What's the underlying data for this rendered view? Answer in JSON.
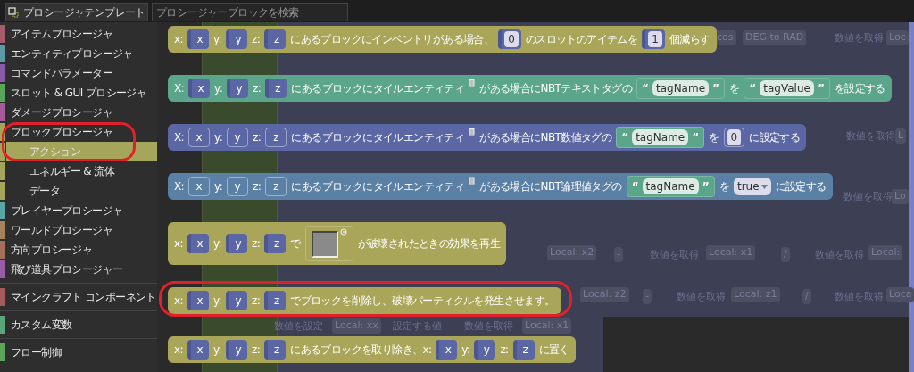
{
  "toolbar": {
    "tab": {
      "label": "プロシージャテンプレート",
      "selected": true
    },
    "search": {
      "placeholder": "プロシージャーブロックを検索"
    }
  },
  "sidebar": {
    "groups": [
      {
        "items": [
          {
            "label": "アイテムプロシージャ",
            "color": "#a55b6b",
            "selected": false
          },
          {
            "label": "エンティティプロシージャ",
            "color": "#5b99a5",
            "selected": false
          },
          {
            "label": "コマンドパラメーター",
            "color": "#8a5ba5",
            "selected": false
          },
          {
            "label": "スロット & GUI プロシージャ",
            "color": "#5ba55b",
            "selected": false
          },
          {
            "label": "ダメージプロシージャ",
            "color": "#a55b99",
            "selected": false
          },
          {
            "label": "ブロックプロシージャ",
            "color": "#a5a55b",
            "selected": false,
            "children": [
              {
                "label": "アクション",
                "color": "#a5a55b",
                "selected": true
              },
              {
                "label": "エネルギー & 流体",
                "color": "#a5a55b",
                "selected": false
              },
              {
                "label": "データ",
                "color": "#a5a55b",
                "selected": false
              }
            ]
          },
          {
            "label": "プレイヤープロシージャ",
            "color": "#5ba5a5",
            "selected": false
          },
          {
            "label": "ワールドプロシージャ",
            "color": "#a5825b",
            "selected": false
          },
          {
            "label": "方向プロシージャ",
            "color": "#a5705b",
            "selected": false
          },
          {
            "label": "飛び道具プロシージャー",
            "color": "#995ba5",
            "selected": false
          }
        ]
      },
      {
        "items": [
          {
            "label": "マインクラフト コンポーネント",
            "color": "#a55b5b",
            "selected": false
          }
        ]
      },
      {
        "items": [
          {
            "label": "カスタム変数",
            "color": "#5ba57a",
            "selected": false
          }
        ]
      },
      {
        "items": [
          {
            "label": "フロー制御",
            "color": "#5ba55b",
            "selected": false
          }
        ]
      }
    ]
  },
  "background_blocks": [
    {
      "kind": "chip",
      "text": "cos"
    },
    {
      "kind": "chip",
      "text": "DEG to RAD"
    },
    {
      "kind": "label",
      "text": "数値を取得"
    },
    {
      "kind": "chip",
      "text": "Loc"
    },
    {
      "kind": "label",
      "text": "数値を取得"
    },
    {
      "kind": "chip",
      "text": "L"
    },
    {
      "kind": "label",
      "text": "数値を取得"
    },
    {
      "kind": "chip",
      "text": "Lo"
    },
    {
      "kind": "chip",
      "text": "Local: x2"
    },
    {
      "kind": "chip",
      "text": "-"
    },
    {
      "kind": "label",
      "text": "数値を取得"
    },
    {
      "kind": "chip",
      "text": "Local: x1"
    },
    {
      "kind": "chip",
      "text": "/"
    },
    {
      "kind": "label",
      "text": "数値を取得"
    },
    {
      "kind": "chip",
      "text": "Local:"
    },
    {
      "kind": "chip",
      "text": "Local: z2"
    },
    {
      "kind": "chip",
      "text": "-"
    },
    {
      "kind": "label",
      "text": "数値を取得"
    },
    {
      "kind": "chip",
      "text": "Local: z1"
    },
    {
      "kind": "chip",
      "text": "/"
    },
    {
      "kind": "label",
      "text": "数値を取得"
    },
    {
      "kind": "chip",
      "text": "Loca"
    },
    {
      "kind": "label",
      "text": "数値を設定"
    },
    {
      "kind": "chip",
      "text": "Local: xx"
    },
    {
      "kind": "label",
      "text": "設定する値"
    },
    {
      "kind": "label",
      "text": "数値を取得"
    },
    {
      "kind": "chip",
      "text": "Local: x1"
    }
  ],
  "blocks": [
    {
      "color": "#a9a65a",
      "highlighted": false,
      "parts": [
        {
          "kind": "label",
          "text": "x:"
        },
        {
          "kind": "var",
          "text": "x"
        },
        {
          "kind": "label",
          "text": "y:"
        },
        {
          "kind": "var",
          "text": "y"
        },
        {
          "kind": "label",
          "text": "z:"
        },
        {
          "kind": "var",
          "text": "z"
        },
        {
          "kind": "label",
          "text": "にあるブロックにインベントリがある場合、"
        },
        {
          "kind": "number",
          "text": "0"
        },
        {
          "kind": "label",
          "text": "のスロットのアイテムを"
        },
        {
          "kind": "number",
          "text": "1"
        },
        {
          "kind": "label",
          "text": "個減らす"
        }
      ]
    },
    {
      "color": "#5ba58a",
      "highlighted": false,
      "parts": [
        {
          "kind": "label",
          "text": "X:"
        },
        {
          "kind": "var",
          "text": "x"
        },
        {
          "kind": "label",
          "text": "y:"
        },
        {
          "kind": "var",
          "text": "y"
        },
        {
          "kind": "label",
          "text": "z:"
        },
        {
          "kind": "var",
          "text": "z"
        },
        {
          "kind": "label",
          "text": "にあるブロックにタイルエンティティ"
        },
        {
          "kind": "icon"
        },
        {
          "kind": "label",
          "text": "がある場合にNBTテキストタグの"
        },
        {
          "kind": "string",
          "open": "“",
          "text": "tagName",
          "close": "”"
        },
        {
          "kind": "label",
          "text": "を"
        },
        {
          "kind": "string",
          "open": "“",
          "text": "tagValue",
          "close": "”"
        },
        {
          "kind": "label",
          "text": "を設定する"
        }
      ]
    },
    {
      "color": "#5b67a5",
      "highlighted": false,
      "parts": [
        {
          "kind": "label",
          "text": "X:"
        },
        {
          "kind": "empty",
          "text": "x"
        },
        {
          "kind": "label",
          "text": "y:"
        },
        {
          "kind": "empty",
          "text": "y"
        },
        {
          "kind": "label",
          "text": "z:"
        },
        {
          "kind": "empty",
          "text": "z"
        },
        {
          "kind": "label",
          "text": "にあるブロックにタイルエンティティ"
        },
        {
          "kind": "icon"
        },
        {
          "kind": "label",
          "text": "がある場合にNBT数値タグの"
        },
        {
          "kind": "string",
          "open": "“",
          "text": "tagName",
          "close": "”"
        },
        {
          "kind": "label",
          "text": "を"
        },
        {
          "kind": "empty_number",
          "text": "0"
        },
        {
          "kind": "label",
          "text": "に設定する"
        }
      ]
    },
    {
      "color": "#5b80a5",
      "highlighted": false,
      "parts": [
        {
          "kind": "label",
          "text": "X:"
        },
        {
          "kind": "empty",
          "text": "x"
        },
        {
          "kind": "label",
          "text": "y:"
        },
        {
          "kind": "empty",
          "text": "y"
        },
        {
          "kind": "label",
          "text": "z:"
        },
        {
          "kind": "empty",
          "text": "z"
        },
        {
          "kind": "label",
          "text": "にあるブロックにタイルエンティティ"
        },
        {
          "kind": "icon"
        },
        {
          "kind": "label",
          "text": "がある場合にNBT論理値タグの"
        },
        {
          "kind": "string",
          "open": "“",
          "text": "tagName",
          "close": "”"
        },
        {
          "kind": "label",
          "text": "を"
        },
        {
          "kind": "dropdown",
          "text": "true"
        },
        {
          "kind": "label",
          "text": "に設定する"
        }
      ]
    },
    {
      "color": "#a9a65a",
      "highlighted": false,
      "parts": [
        {
          "kind": "label",
          "text": "x:"
        },
        {
          "kind": "var",
          "text": "x"
        },
        {
          "kind": "label",
          "text": "y:"
        },
        {
          "kind": "var",
          "text": "y"
        },
        {
          "kind": "label",
          "text": "z:"
        },
        {
          "kind": "var",
          "text": "z"
        },
        {
          "kind": "label",
          "text": "で"
        },
        {
          "kind": "swatch"
        },
        {
          "kind": "label",
          "text": "が破壊されたときの効果を再生"
        }
      ]
    },
    {
      "color": "#a9a65a",
      "highlighted": true,
      "parts": [
        {
          "kind": "label",
          "text": "x:"
        },
        {
          "kind": "var",
          "text": "x"
        },
        {
          "kind": "label",
          "text": "y:"
        },
        {
          "kind": "var",
          "text": "y"
        },
        {
          "kind": "label",
          "text": "z:"
        },
        {
          "kind": "var",
          "text": "z"
        },
        {
          "kind": "label",
          "text": "でブロックを削除し、破壊パーティクルを発生させます。"
        }
      ]
    },
    {
      "color": "#a9a65a",
      "highlighted": false,
      "parts": [
        {
          "kind": "label",
          "text": "x:"
        },
        {
          "kind": "var",
          "text": "x"
        },
        {
          "kind": "label",
          "text": "y:"
        },
        {
          "kind": "var",
          "text": "y"
        },
        {
          "kind": "label",
          "text": "z:"
        },
        {
          "kind": "var",
          "text": "z"
        },
        {
          "kind": "label",
          "text": "にあるブロックを取り除き、x:"
        },
        {
          "kind": "var",
          "text": "x"
        },
        {
          "kind": "label",
          "text": "y:"
        },
        {
          "kind": "var",
          "text": "y"
        },
        {
          "kind": "label",
          "text": "z:"
        },
        {
          "kind": "var",
          "text": "z"
        },
        {
          "kind": "label",
          "text": "に置く"
        }
      ]
    }
  ]
}
